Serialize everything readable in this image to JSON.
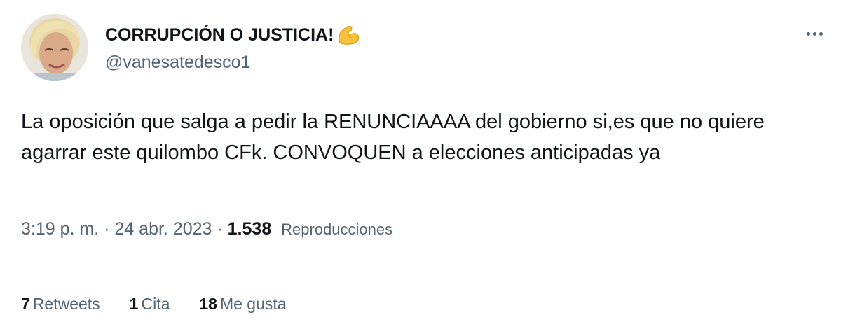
{
  "author": {
    "display_name": "CORRUPCIÓN O JUSTICIA!",
    "emoji": "flexed-biceps-emoji",
    "handle": "@vanesatedesco1"
  },
  "tweet": {
    "text": "La oposición que salga a pedir la RENUNCIAAAA del gobierno si,es que no quiere agarrar este quilombo CFk. CONVOQUEN a elecciones anticipadas ya",
    "time": "3:19 p. m.",
    "separator": "·",
    "date": "24 abr. 2023",
    "views_count": "1.538",
    "views_label": "Reproducciones"
  },
  "stats": {
    "retweets_count": "7",
    "retweets_label": "Retweets",
    "quotes_count": "1",
    "quotes_label": "Cita",
    "likes_count": "18",
    "likes_label": "Me gusta"
  },
  "icons": {
    "more": "more-options-icon"
  },
  "colors": {
    "text_primary": "#0f1419",
    "text_secondary": "#536471",
    "divider": "#dde3e8",
    "emoji": "#f5c23a"
  }
}
